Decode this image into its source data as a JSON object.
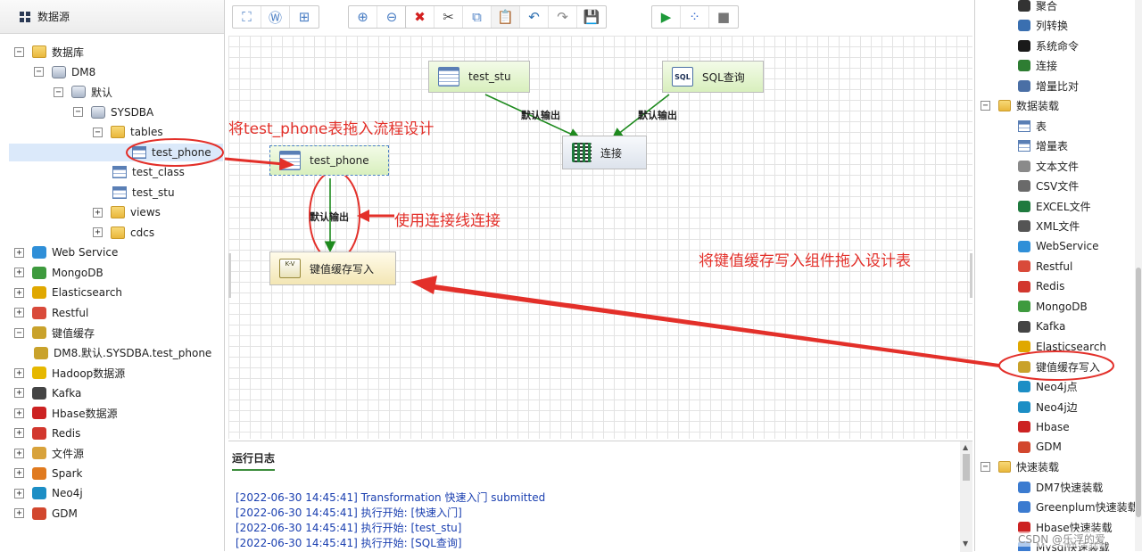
{
  "left_panel": {
    "title": "数据源",
    "tree": [
      {
        "label": "数据库",
        "toggle": "−",
        "icon": "database-icon"
      },
      {
        "label": "DM8",
        "toggle": "−",
        "icon": "db-server-icon"
      },
      {
        "label": "默认",
        "toggle": "−",
        "icon": "db-icon"
      },
      {
        "label": "SYSDBA",
        "toggle": "−",
        "icon": "schema-icon"
      },
      {
        "label": "tables",
        "toggle": "−",
        "icon": "folder-icon"
      },
      {
        "label": "test_phone",
        "toggle": "",
        "icon": "table-icon"
      },
      {
        "label": "test_class",
        "toggle": "",
        "icon": "table-icon"
      },
      {
        "label": "test_stu",
        "toggle": "",
        "icon": "table-icon"
      },
      {
        "label": "views",
        "toggle": "+",
        "icon": "folder-icon"
      },
      {
        "label": "cdcs",
        "toggle": "+",
        "icon": "folder-icon"
      },
      {
        "label": "Web Service",
        "toggle": "+",
        "icon": "webservice-icon"
      },
      {
        "label": "MongoDB",
        "toggle": "+",
        "icon": "mongodb-icon"
      },
      {
        "label": "Elasticsearch",
        "toggle": "+",
        "icon": "elasticsearch-icon"
      },
      {
        "label": "Restful",
        "toggle": "+",
        "icon": "restful-icon"
      },
      {
        "label": "键值缓存",
        "toggle": "−",
        "icon": "kv-icon"
      },
      {
        "label": "DM8.默认.SYSDBA.test_phone",
        "toggle": "",
        "icon": "kv-icon"
      },
      {
        "label": "Hadoop数据源",
        "toggle": "+",
        "icon": "hadoop-icon"
      },
      {
        "label": "Kafka",
        "toggle": "+",
        "icon": "kafka-icon"
      },
      {
        "label": "Hbase数据源",
        "toggle": "+",
        "icon": "hbase-icon"
      },
      {
        "label": "Redis",
        "toggle": "+",
        "icon": "redis-icon"
      },
      {
        "label": "文件源",
        "toggle": "+",
        "icon": "file-icon"
      },
      {
        "label": "Spark",
        "toggle": "+",
        "icon": "spark-icon"
      },
      {
        "label": "Neo4j",
        "toggle": "+",
        "icon": "neo4j-icon"
      },
      {
        "label": "GDM",
        "toggle": "+",
        "icon": "gdm-icon"
      }
    ]
  },
  "toolbar": {
    "groups": [
      [
        "⛶",
        "Ⓦ",
        "⊞"
      ],
      [
        "⊕",
        "⊖"
      ],
      [
        "✖",
        "✂",
        "⧉",
        "📋",
        "↶",
        "↷",
        "💾"
      ],
      [
        "▶",
        "⁘",
        "■"
      ]
    ]
  },
  "canvas": {
    "nodes": {
      "test_stu": "test_stu",
      "sql_query": "SQL查询",
      "join": "连接",
      "test_phone": "test_phone",
      "kv_write": "键值缓存写入"
    },
    "sql_badge": "SQL",
    "kv_badge": "K-V",
    "edge_labels": {
      "left": "默认输出",
      "right": "默认输出",
      "down": "默认输出"
    }
  },
  "annotations": {
    "drag_table": "将test_phone表拖入流程设计",
    "connect": "使用连接线连接",
    "drag_component": "将键值缓存写入组件拖入设计表"
  },
  "log": {
    "title": "运行日志",
    "lines": [
      "[2022-06-30 14:45:41] Transformation 快速入门 submitted",
      "[2022-06-30 14:45:41] 执行开始: [快速入门]",
      "[2022-06-30 14:45:41] 执行开始: [test_stu]",
      "[2022-06-30 14:45:41] 执行开始: [SQL查询]"
    ]
  },
  "right_panel": {
    "items": [
      {
        "label": "聚合",
        "toggle": "",
        "icon": "sigma-icon"
      },
      {
        "label": "列转换",
        "toggle": "",
        "icon": "column-convert-icon"
      },
      {
        "label": "系统命令",
        "toggle": "",
        "icon": "terminal-icon"
      },
      {
        "label": "连接",
        "toggle": "",
        "icon": "join-icon"
      },
      {
        "label": "增量比对",
        "toggle": "",
        "icon": "compare-icon"
      },
      {
        "label": "数据装载",
        "toggle": "−",
        "icon": "folder-icon"
      },
      {
        "label": "表",
        "toggle": "",
        "icon": "table-icon"
      },
      {
        "label": "增量表",
        "toggle": "",
        "icon": "table-icon"
      },
      {
        "label": "文本文件",
        "toggle": "",
        "icon": "text-file-icon"
      },
      {
        "label": "CSV文件",
        "toggle": "",
        "icon": "csv-icon"
      },
      {
        "label": "EXCEL文件",
        "toggle": "",
        "icon": "excel-icon"
      },
      {
        "label": "XML文件",
        "toggle": "",
        "icon": "xml-icon"
      },
      {
        "label": "WebService",
        "toggle": "",
        "icon": "webservice-icon"
      },
      {
        "label": "Restful",
        "toggle": "",
        "icon": "restful-icon"
      },
      {
        "label": "Redis",
        "toggle": "",
        "icon": "redis-icon"
      },
      {
        "label": "MongoDB",
        "toggle": "",
        "icon": "mongodb-icon"
      },
      {
        "label": "Kafka",
        "toggle": "",
        "icon": "kafka-icon"
      },
      {
        "label": "Elasticsearch",
        "toggle": "",
        "icon": "elasticsearch-icon"
      },
      {
        "label": "键值缓存写入",
        "toggle": "",
        "icon": "kv-icon"
      },
      {
        "label": "Neo4j点",
        "toggle": "",
        "icon": "neo4j-icon"
      },
      {
        "label": "Neo4j边",
        "toggle": "",
        "icon": "neo4j-icon"
      },
      {
        "label": "Hbase",
        "toggle": "",
        "icon": "hbase-icon"
      },
      {
        "label": "GDM",
        "toggle": "",
        "icon": "gdm-icon"
      },
      {
        "label": "快速装载",
        "toggle": "−",
        "icon": "folder-icon"
      },
      {
        "label": "DM7快速装载",
        "toggle": "",
        "icon": "fast-load-icon"
      },
      {
        "label": "Greenplum快速装载",
        "toggle": "",
        "icon": "fast-load-icon"
      },
      {
        "label": "Hbase快速装载",
        "toggle": "",
        "icon": "hbase-icon"
      },
      {
        "label": "Mysql快速装载",
        "toggle": "",
        "icon": "fast-load-icon"
      }
    ]
  },
  "watermark": "CSDN @乐浮的爱"
}
